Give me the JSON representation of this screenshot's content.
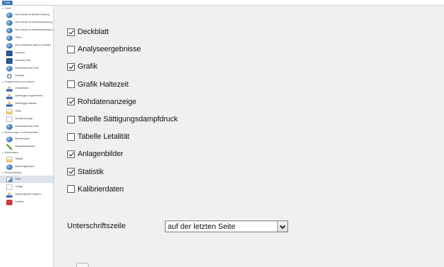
{
  "topbar": {
    "file_label": "Datei"
  },
  "sidebar": {
    "sections": [
      {
        "title": "Studie",
        "items": [
          {
            "label": "Neue Studie mit aktueller Messung",
            "icon": "globe-icon"
          },
          {
            "label": "Neue Studie mit Stichprobenmessung",
            "icon": "globe-icon"
          },
          {
            "label": "Neue Studie mit Rohdatenmessung einladen",
            "icon": "globe-icon"
          },
          {
            "label": "Öffnen",
            "icon": "globe-icon"
          },
          {
            "label": "Aus vorhandener Datei neu erstellen",
            "icon": "globe-icon"
          },
          {
            "label": "Speichern",
            "icon": "save-icon"
          },
          {
            "label": "Speichern unter",
            "icon": "save-icon"
          },
          {
            "label": "Datenexport nach Excel",
            "icon": "globe-icon"
          },
          {
            "label": "Einheiten",
            "icon": "gear-icon"
          }
        ]
      },
      {
        "title": "Programmieren und Auslesen",
        "items": [
          {
            "label": "Analysedaten",
            "icon": "person-icon"
          },
          {
            "label": "Datenlogger programmieren",
            "icon": "person-icon"
          },
          {
            "label": "Datenlogger auslesen",
            "icon": "person-icon"
          },
          {
            "label": "Grafik",
            "icon": "chart-icon"
          },
          {
            "label": "Rohdatenanzeige",
            "icon": "doc-icon"
          },
          {
            "label": "Datenexport nach Excel",
            "icon": "globe-icon"
          }
        ]
      },
      {
        "title": "Berechnungen und Beispieldaten",
        "items": [
          {
            "label": "Berechnungen",
            "icon": "globe-icon"
          },
          {
            "label": "Beispieldaten/Daten",
            "icon": "wrench-icon"
          }
        ]
      },
      {
        "title": "Datenanalyse",
        "items": [
          {
            "label": "Statistik",
            "icon": "chart-icon"
          },
          {
            "label": "Bedienungshinweis",
            "icon": "globe-icon"
          }
        ]
      },
      {
        "title": "Berichterstellung",
        "items": [
          {
            "label": "Inhalt",
            "icon": "sig-icon",
            "active": true
          },
          {
            "label": "Vorlage",
            "icon": "doc-icon"
          },
          {
            "label": "Ansprechpartner eingeben",
            "icon": "person-icon"
          },
          {
            "label": "Erstellen",
            "icon": "exit-icon"
          }
        ]
      }
    ]
  },
  "options": [
    {
      "label": "Deckblatt",
      "checked": true
    },
    {
      "label": "Analyseergebnisse",
      "checked": false
    },
    {
      "label": "Grafik",
      "checked": true
    },
    {
      "label": "Grafik Haltezeit",
      "checked": false
    },
    {
      "label": "Rohdatenanzeige",
      "checked": true
    },
    {
      "label": "Tabelle Sättigungsdampfdruck",
      "checked": false
    },
    {
      "label": "Tabelle Letalität",
      "checked": false
    },
    {
      "label": "Anlagenbilder",
      "checked": true
    },
    {
      "label": "Statistik",
      "checked": true
    },
    {
      "label": "Kalibrierdaten",
      "checked": false
    }
  ],
  "signature": {
    "label": "Unterschriftszeile",
    "selected": "auf der letzten Seite"
  }
}
